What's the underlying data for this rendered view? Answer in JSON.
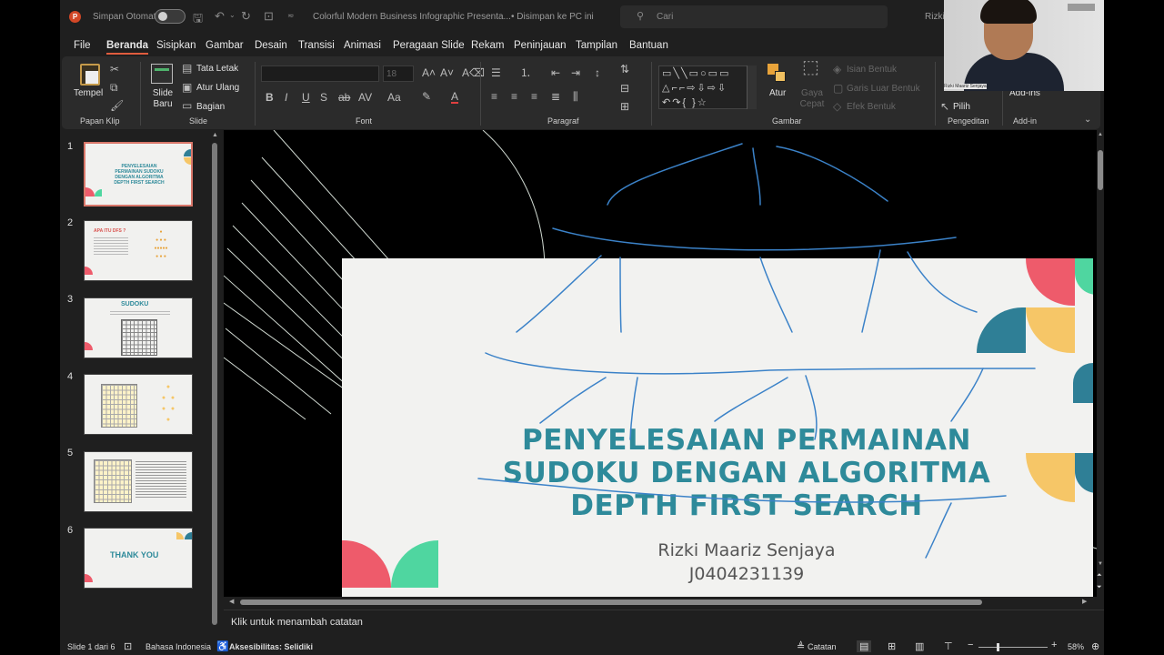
{
  "titlebar": {
    "autosave_label": "Simpan Otomatis",
    "doc_title": "Colorful Modern Business Infographic Presenta...",
    "saved_state": "• Disimpan ke PC ini",
    "search_placeholder": "Cari",
    "user_name": "Rizki"
  },
  "menu": [
    "File",
    "Beranda",
    "Sisipkan",
    "Gambar",
    "Desain",
    "Transisi",
    "Animasi",
    "Peragaan Slide",
    "Rekam",
    "Peninjauan",
    "Tampilan",
    "Bantuan"
  ],
  "ribbon": {
    "clipboard": {
      "paste": "Tempel",
      "group": "Papan Klip"
    },
    "slides": {
      "new_slide": "Slide Baru",
      "layout": "Tata Letak",
      "reset": "Atur Ulang",
      "section": "Bagian",
      "group": "Slide"
    },
    "font": {
      "size": "18",
      "group": "Font"
    },
    "paragraph": {
      "group": "Paragraf"
    },
    "drawing": {
      "arrange": "Atur",
      "quick_styles": "Gaya Cepat",
      "shape_fill": "Isian Bentuk",
      "shape_outline": "Garis Luar Bentuk",
      "shape_effects": "Efek Bentuk",
      "group": "Gambar"
    },
    "editing": {
      "select": "Pilih",
      "group": "Pengeditan"
    },
    "addins": {
      "label": "Add-ins",
      "group": "Add-in"
    }
  },
  "thumbnails": [
    {
      "num": "1",
      "title": "PENYELESAIAN PERMAINAN SUDOKU DENGAN ALGORITMA DEPTH FIRST SEARCH"
    },
    {
      "num": "2",
      "title": "APA ITU DFS ?"
    },
    {
      "num": "3",
      "title": "SUDOKU"
    },
    {
      "num": "4",
      "title": ""
    },
    {
      "num": "5",
      "title": ""
    },
    {
      "num": "6",
      "title": "THANK YOU"
    }
  ],
  "slide": {
    "title_lines": [
      "PENYELESAIAN PERMAINAN",
      "SUDOKU DENGAN ALGORITMA",
      "DEPTH FIRST SEARCH"
    ],
    "author": "Rizki Maariz Senjaya",
    "id": "J0404231139"
  },
  "notes_placeholder": "Klik untuk menambah catatan",
  "status": {
    "slide_of": "Slide 1 dari 6",
    "language": "Bahasa Indonesia",
    "accessibility": "Aksesibilitas: Selidiki",
    "notes_btn": "Catatan",
    "zoom": "58%"
  },
  "webcam": {
    "caption": "Rizki Maariz Senjaya"
  },
  "colors": {
    "accent": "#e05c3e",
    "title_teal": "#2e8a9a",
    "pen_blue": "#3b82c8",
    "pink": "#ee5b6b",
    "green": "#4fd6a0",
    "yellow": "#f6c667",
    "teal": "#2f7f96"
  }
}
